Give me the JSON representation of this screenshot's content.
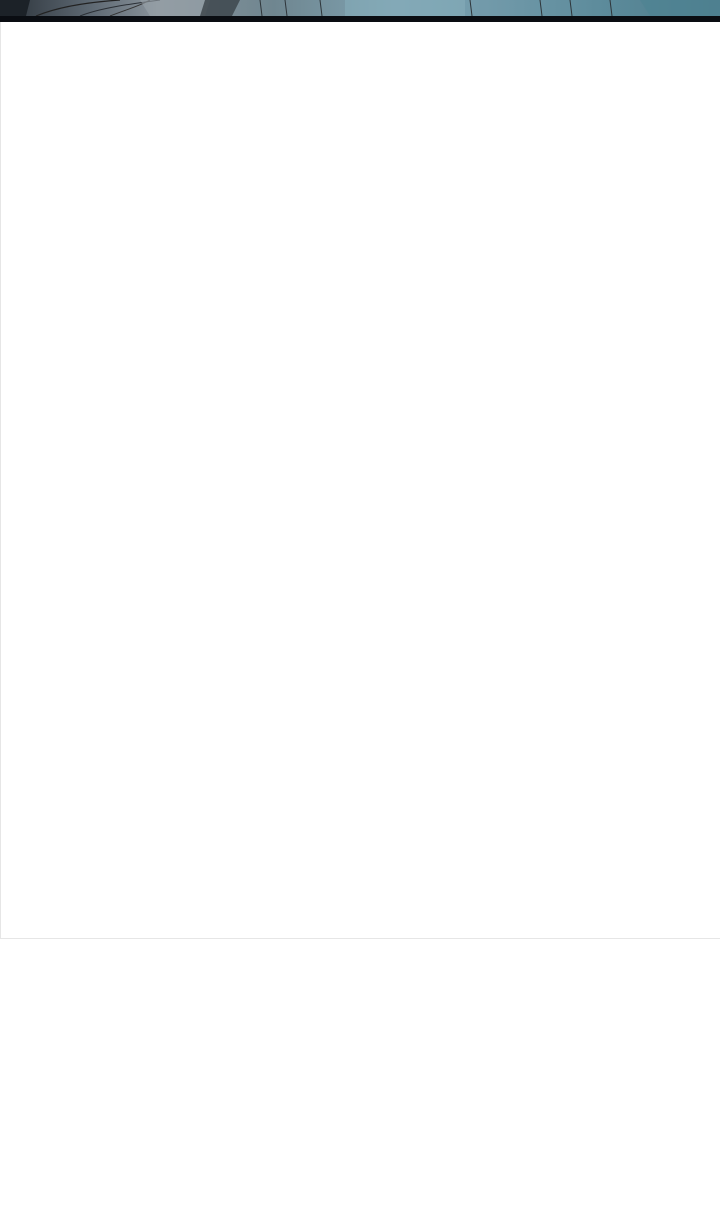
{
  "screen": {
    "banner_image": "comic-panel-image",
    "content": "blank"
  },
  "colors": {
    "background": "#ffffff",
    "banner_dark": "#0a0d12",
    "banner_teal": "#6f98a8",
    "divider": "#e6e6e6"
  }
}
